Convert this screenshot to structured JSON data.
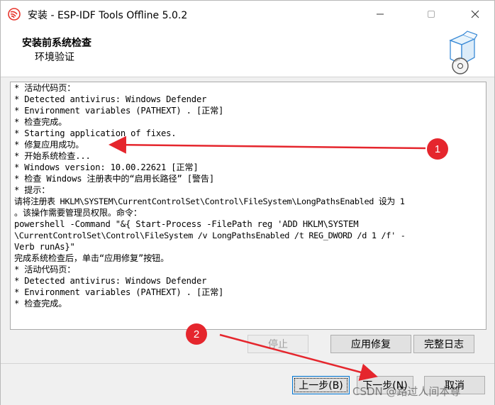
{
  "window": {
    "title": "安装 - ESP-IDF Tools Offline 5.0.2"
  },
  "header": {
    "title": "安装前系统检查",
    "subtitle": "环境验证",
    "icon": "installer-box-disc-icon"
  },
  "log": {
    "lines": [
      "* 活动代码页：",
      "* Detected antivirus: Windows Defender",
      "* Environment variables (PATHEXT) . [正常]",
      "* 检查完成。",
      "* Starting application of fixes.",
      "* 修复应用成功。",
      "* 开始系统检查...",
      "* Windows version: 10.00.22621 [正常]",
      "* 检查 Windows 注册表中的“启用长路径” [警告]",
      "* 提示：",
      "请将注册表 HKLM\\SYSTEM\\CurrentControlSet\\Control\\FileSystem\\LongPathsEnabled 设为 1",
      "。该操作需要管理员权限。命令：",
      "powershell -Command \"&{ Start-Process -FilePath reg 'ADD HKLM\\SYSTEM",
      "\\CurrentControlSet\\Control\\FileSystem /v LongPathsEnabled /t REG_DWORD /d 1 /f' -",
      "Verb runAs}\"",
      "完成系统检查后，单击“应用修复”按钮。",
      "* 活动代码页：",
      "* Detected antivirus: Windows Defender",
      "* Environment variables (PATHEXT) . [正常]",
      "* 检查完成。"
    ]
  },
  "actions": {
    "stop_label": "停止",
    "apply_fix_label": "应用修复",
    "full_log_label": "完整日志"
  },
  "footer": {
    "back_label": "上一步(B)",
    "next_label": "下一步(N)",
    "cancel_label": "取消"
  },
  "annotations": {
    "badge_1": "1",
    "badge_2": "2",
    "color": "#e5262d"
  },
  "watermark": "CSDN @路过人间本尊"
}
